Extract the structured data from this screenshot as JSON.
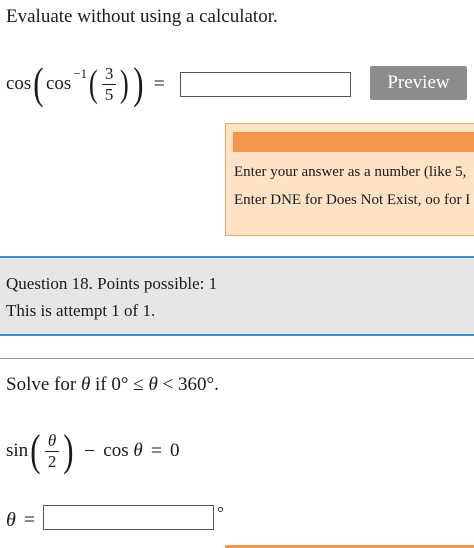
{
  "question17": {
    "prompt": "Evaluate without using a calculator.",
    "cos_outer": "cos",
    "cos_inner": "cos",
    "inverse_exp": "−1",
    "frac_num": "3",
    "frac_den": "5",
    "equals": "=",
    "answer_value": "",
    "preview_label": "Preview",
    "help_line1": "Enter your answer as a number (like 5,",
    "help_line2": "Enter DNE for Does Not Exist, oo for I"
  },
  "question18": {
    "title": "Question 18. Points possible: 1",
    "attempt": "This is attempt 1 of 1.",
    "prompt_prefix": "Solve for",
    "prompt_theta": "θ",
    "prompt_if": "if 0°",
    "prompt_leq": "≤",
    "prompt_theta2": "θ",
    "prompt_lt": "<",
    "prompt_end": "360°.",
    "eq_sin": "sin",
    "eq_num": "θ",
    "eq_den": "2",
    "eq_minus": "−",
    "eq_cos": "cos",
    "eq_theta": "θ",
    "eq_equals": "=",
    "eq_zero": "0",
    "answer_label_theta": "θ",
    "answer_label_equals": "=",
    "answer_value": "",
    "degree_symbol": "°"
  },
  "colors": {
    "preview_button": "#8c8c8c",
    "help_background": "#fde2c5",
    "help_bar": "#f4954a",
    "divider_blue": "#3a8ed4",
    "question_info_background": "#e6e6e6"
  }
}
